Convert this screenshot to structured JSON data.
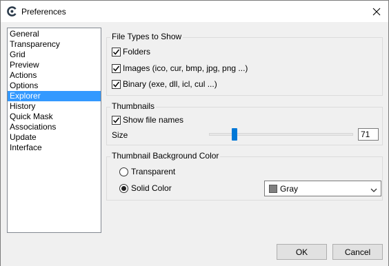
{
  "window": {
    "title": "Preferences"
  },
  "sidebar": {
    "items": [
      {
        "label": "General",
        "selected": false
      },
      {
        "label": "Transparency",
        "selected": false
      },
      {
        "label": "Grid",
        "selected": false
      },
      {
        "label": "Preview",
        "selected": false
      },
      {
        "label": "Actions",
        "selected": false
      },
      {
        "label": "Options",
        "selected": false
      },
      {
        "label": "Explorer",
        "selected": true
      },
      {
        "label": "History",
        "selected": false
      },
      {
        "label": "Quick Mask",
        "selected": false
      },
      {
        "label": "Associations",
        "selected": false
      },
      {
        "label": "Update",
        "selected": false
      },
      {
        "label": "Interface",
        "selected": false
      }
    ],
    "selected_color": "#3399ff"
  },
  "file_types": {
    "title": "File Types to Show",
    "options": [
      {
        "label": "Folders",
        "checked": true
      },
      {
        "label": "Images (ico, cur, bmp, jpg, png ...)",
        "checked": true
      },
      {
        "label": "Binary (exe, dll, icl, cul ...)",
        "checked": true
      }
    ]
  },
  "thumbnails": {
    "title": "Thumbnails",
    "show_file_names_label": "Show file names",
    "show_file_names_checked": true,
    "size_label": "Size",
    "size_value": "71",
    "slider_fraction": 0.16
  },
  "background": {
    "title": "Thumbnail Background Color",
    "transparent_label": "Transparent",
    "transparent_selected": false,
    "solid_label": "Solid Color",
    "solid_selected": true,
    "color_name": "Gray",
    "color_hex": "#808080"
  },
  "buttons": {
    "ok": "OK",
    "cancel": "Cancel"
  },
  "icons": {
    "app": "app-logo-icon",
    "close": "close-icon",
    "check": "checkmark-icon",
    "dropdown": "chevron-down-icon"
  }
}
